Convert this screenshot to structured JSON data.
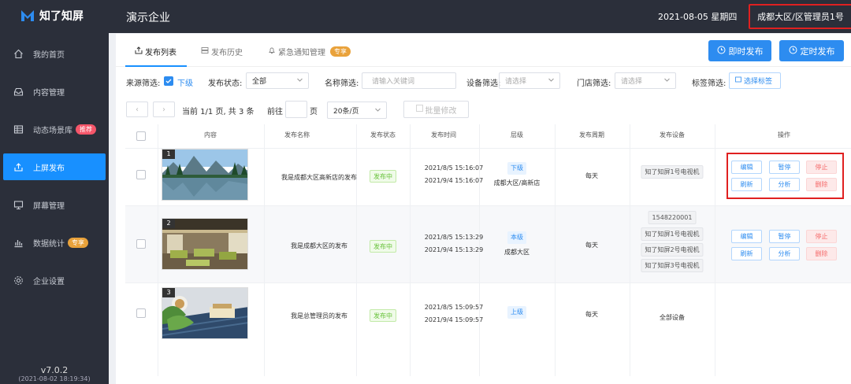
{
  "app": {
    "logo_text": "知了知屏",
    "version": "v7.0.2",
    "build_time": "(2021-08-02 18:19:34)"
  },
  "sidebar": {
    "items": [
      {
        "label": "我的首页",
        "icon": "home-icon"
      },
      {
        "label": "内容管理",
        "icon": "inbox-icon"
      },
      {
        "label": "动态场景库",
        "icon": "table-icon",
        "badge": "推荐"
      },
      {
        "label": "上屏发布",
        "icon": "upload-icon",
        "active": true
      },
      {
        "label": "屏幕管理",
        "icon": "monitor-icon"
      },
      {
        "label": "数据统计",
        "icon": "chart-icon",
        "badge": "专享"
      },
      {
        "label": "企业设置",
        "icon": "gear-icon"
      }
    ]
  },
  "header": {
    "company": "演示企业",
    "date": "2021-08-05 星期四",
    "user": "成都大区/区管理员1号"
  },
  "tabs": [
    {
      "label": "发布列表",
      "active": true
    },
    {
      "label": "发布历史"
    },
    {
      "label": "紧急通知管理",
      "badge": "专享"
    }
  ],
  "actions": {
    "publish_now": "即时发布",
    "publish_timed": "定时发布"
  },
  "filters": {
    "source_label": "来源筛选:",
    "source_option": "下级",
    "status_label": "发布状态:",
    "status_value": "全部",
    "name_label": "名称筛选:",
    "name_placeholder": "请输入关键词",
    "device_label": "设备筛选:",
    "device_placeholder": "请选择",
    "store_label": "门店筛选:",
    "store_placeholder": "请选择",
    "tag_label": "标签筛选:",
    "tag_button": "选择标签"
  },
  "pagination": {
    "summary": "当前 1/1 页, 共 3 条",
    "goto_label": "前往",
    "page_unit": "页",
    "page_size": "20条/页",
    "batch_edit": "批量修改"
  },
  "table": {
    "headers": [
      "内容",
      "发布名称",
      "发布状态",
      "发布时间",
      "层级",
      "发布周期",
      "发布设备",
      "操作"
    ],
    "ops": {
      "edit": "编辑",
      "pause": "暂停",
      "stop": "停止",
      "refresh": "刷新",
      "analyze": "分析",
      "delete": "删除"
    },
    "rows": [
      {
        "num": "1",
        "name": "我是成都大区高新店的发布",
        "status": "发布中",
        "time_start": "2021/8/5 15:16:07",
        "time_end": "2021/9/4 15:16:07",
        "level": "下级",
        "level_sub": "成都大区/高新店",
        "cycle": "每天",
        "devices": [
          "知了知屏1号电视机"
        ]
      },
      {
        "num": "2",
        "name": "我是成都大区的发布",
        "status": "发布中",
        "time_start": "2021/8/5 15:13:29",
        "time_end": "2021/9/4 15:13:29",
        "level": "本级",
        "level_sub": "成都大区",
        "cycle": "每天",
        "devices": [
          "1548220001",
          "知了知屏1号电视机",
          "知了知屏2号电视机",
          "知了知屏3号电视机"
        ]
      },
      {
        "num": "3",
        "name": "我是总管理员的发布",
        "status": "发布中",
        "time_start": "2021/8/5 15:09:57",
        "time_end": "2021/9/4 15:09:57",
        "level": "上级",
        "level_sub": "",
        "cycle": "每天",
        "devices_text": "全部设备"
      }
    ]
  },
  "colors": {
    "sidebar_bg": "#2b2f3a",
    "primary": "#2d8cf0",
    "danger": "#f56c6c",
    "success": "#67c23a",
    "highlight": "#e02020"
  }
}
